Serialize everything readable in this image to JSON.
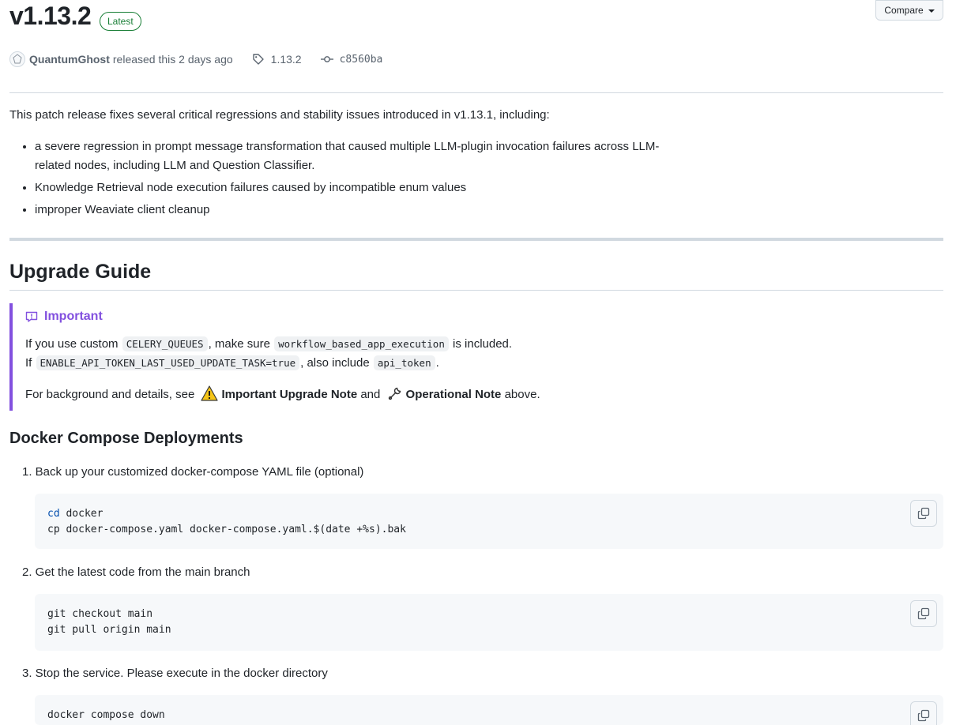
{
  "release": {
    "title": "v1.13.2",
    "badge": "Latest",
    "compare_label": "Compare",
    "author": "QuantumGhost",
    "released_text": "released this 2 days ago",
    "tag": "1.13.2",
    "commit": "c8560ba"
  },
  "intro": "This patch release fixes several critical regressions and stability issues introduced in v1.13.1, including:",
  "bullets": [
    "a severe regression in prompt message transformation that caused multiple LLM-plugin invocation failures across LLM-related nodes, including LLM and Question Classifier.",
    "Knowledge Retrieval node execution failures caused by incompatible enum values",
    "improper Weaviate client cleanup"
  ],
  "upgrade_guide": {
    "heading": "Upgrade Guide",
    "callout": {
      "title": "Important",
      "line1": {
        "p1": "If you use custom",
        "c1": "CELERY_QUEUES",
        "p2": ", make sure",
        "c2": "workflow_based_app_execution",
        "p3": "is included."
      },
      "line2": {
        "p1": "If",
        "c1": "ENABLE_API_TOKEN_LAST_USED_UPDATE_TASK=true",
        "p2": ", also include",
        "c2": "api_token",
        "p3": "."
      },
      "line3": {
        "p1": "For background and details, see",
        "link1": "Important Upgrade Note",
        "p2": "and",
        "link2": "Operational Note",
        "p3": "above."
      }
    }
  },
  "docker": {
    "heading": "Docker Compose Deployments",
    "steps": [
      {
        "label": "1. Back up your customized docker-compose YAML file (optional)",
        "code_lines": [
          {
            "kw": "cd",
            "rest": " docker"
          },
          {
            "kw": "",
            "rest": "cp docker-compose.yaml docker-compose.yaml.$(date +%s).bak"
          }
        ]
      },
      {
        "label": "2. Get the latest code from the main branch",
        "code_lines": [
          {
            "kw": "",
            "rest": "git checkout main"
          },
          {
            "kw": "",
            "rest": "git pull origin main"
          }
        ]
      },
      {
        "label": "3. Stop the service. Please execute in the docker directory",
        "code_lines": [
          {
            "kw": "",
            "rest": "docker compose down"
          }
        ]
      }
    ]
  },
  "colors": {
    "latest_badge": "#1a7f37",
    "important_accent": "#8250df",
    "code_keyword": "#0550ae"
  }
}
